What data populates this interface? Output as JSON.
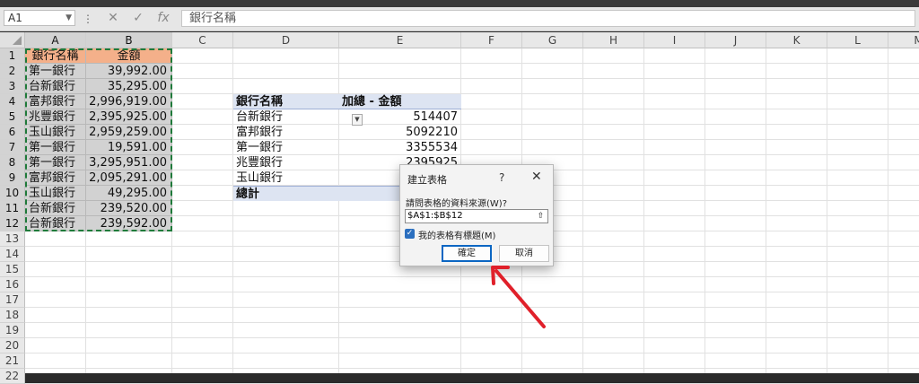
{
  "formula_bar": {
    "name_box": "A1",
    "fx_label": "fx",
    "content": "銀行名稱"
  },
  "columns": [
    "A",
    "B",
    "C",
    "D",
    "E",
    "F",
    "G",
    "H",
    "I",
    "J",
    "K",
    "L",
    "M"
  ],
  "rows": [
    "1",
    "2",
    "3",
    "4",
    "5",
    "6",
    "7",
    "8",
    "9",
    "10",
    "11",
    "12",
    "13",
    "14",
    "15",
    "16",
    "17",
    "18",
    "19",
    "20",
    "21",
    "22"
  ],
  "table": {
    "header": [
      "銀行名稱",
      "金額"
    ],
    "rows": [
      [
        "第一銀行",
        "39,992.00"
      ],
      [
        "台新銀行",
        "35,295.00"
      ],
      [
        "富邦銀行",
        "2,996,919.00"
      ],
      [
        "兆豐銀行",
        "2,395,925.00"
      ],
      [
        "玉山銀行",
        "2,959,259.00"
      ],
      [
        "第一銀行",
        "19,591.00"
      ],
      [
        "第一銀行",
        "3,295,951.00"
      ],
      [
        "富邦銀行",
        "2,095,291.00"
      ],
      [
        "玉山銀行",
        "49,295.00"
      ],
      [
        "台新銀行",
        "239,520.00"
      ],
      [
        "台新銀行",
        "239,592.00"
      ]
    ]
  },
  "pivot": {
    "header_label": "銀行名稱",
    "value_header": "加總 - 金額",
    "rows": [
      [
        "台新銀行",
        "514407"
      ],
      [
        "富邦銀行",
        "5092210"
      ],
      [
        "第一銀行",
        "3355534"
      ],
      [
        "兆豐銀行",
        "2395925"
      ],
      [
        "玉山銀行",
        ""
      ]
    ],
    "total_label": "總計"
  },
  "dialog": {
    "title": "建立表格",
    "help": "?",
    "close": "✕",
    "prompt": "請問表格的資料來源(W)?",
    "range_value": "$A$1:$B$12",
    "collapse_icon": "⇧",
    "checkbox_label": "我的表格有標題(M)",
    "checkbox_checked": true,
    "ok_label": "確定",
    "cancel_label": "取消"
  },
  "colors": {
    "header_fill": "#f4b08a",
    "selection_fill": "#d2d2d2",
    "marquee": "#1f7a3a",
    "pivot_fill": "#dde4f2",
    "arrow": "#e0202a",
    "ok_border": "#0b66c3"
  }
}
